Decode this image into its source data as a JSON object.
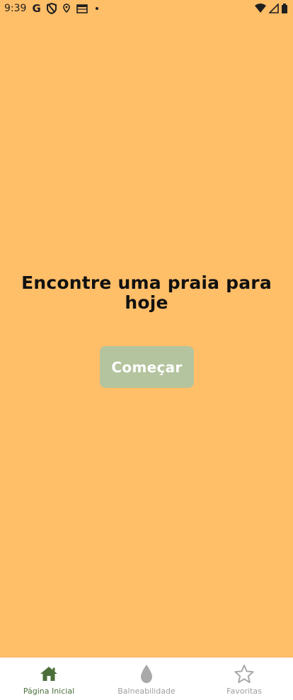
{
  "statusbar": {
    "time": "9:39",
    "google_mark": "G",
    "icons_left": [
      "google-icon",
      "shield-icon",
      "location-icon",
      "calendar-icon",
      "dot-icon"
    ],
    "icons_right": [
      "wifi-icon",
      "signal-icon",
      "battery-icon"
    ]
  },
  "main": {
    "headline": "Encontre uma praia para hoje",
    "cta_label": "Começar"
  },
  "nav": {
    "items": [
      {
        "label": "Página Inicial",
        "icon": "home-icon",
        "active": true
      },
      {
        "label": "Balneabilidade",
        "icon": "drop-icon",
        "active": false
      },
      {
        "label": "Favoritas",
        "icon": "star-icon",
        "active": false
      }
    ]
  },
  "colors": {
    "background": "#FFBE68",
    "cta_background": "#B4C49E",
    "nav_active": "#4C6F3A",
    "nav_inactive": "#9E9E9E"
  }
}
